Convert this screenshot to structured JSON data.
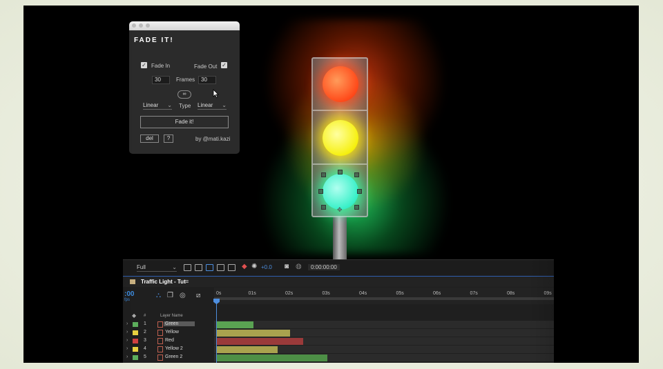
{
  "fade_panel": {
    "title": "FADE IT!",
    "fade_in_label": "Fade In",
    "fade_in_checked": true,
    "fade_out_label": "Fade Out",
    "fade_out_checked": true,
    "frames_label": "Frames",
    "frames_in": "30",
    "frames_out": "30",
    "link_icon": "link-icon",
    "type_label": "Type",
    "type_in": "Linear",
    "type_out": "Linear",
    "fade_button": "Fade it!",
    "del_button": "del",
    "help_button": "?",
    "credit": "by @mati.kazi"
  },
  "viewer_toolbar": {
    "resolution": "Full",
    "exposure": "+0.0",
    "timecode": "0:00:00:00"
  },
  "timeline": {
    "comp_tab": "Traffic Light - Tut",
    "current_time": ":00",
    "current_frame": "fps",
    "col_number": "#",
    "col_name": "Layer Name",
    "ticks": [
      "0s",
      "01s",
      "02s",
      "03s",
      "04s",
      "05s",
      "06s",
      "07s",
      "08s",
      "09s"
    ],
    "duration_seconds": 9.2,
    "layers": [
      {
        "num": "1",
        "name": "Green",
        "label_color": "#5cae5c",
        "bar_color": "#5aa352",
        "start": 0.0,
        "end": 1.0,
        "selected": true
      },
      {
        "num": "2",
        "name": "Yellow",
        "label_color": "#e8d040",
        "bar_color": "#a9a24e",
        "start": 0.0,
        "end": 2.0,
        "selected": false
      },
      {
        "num": "3",
        "name": "Red",
        "label_color": "#d04040",
        "bar_color": "#9a3a3a",
        "start": 0.0,
        "end": 2.35,
        "selected": false
      },
      {
        "num": "4",
        "name": "Yellow 2",
        "label_color": "#e8d040",
        "bar_color": "#a9a24e",
        "start": 0.0,
        "end": 1.67,
        "selected": false
      },
      {
        "num": "5",
        "name": "Green 2",
        "label_color": "#5cae5c",
        "bar_color": "#4d8f46",
        "start": 0.0,
        "end": 3.0,
        "selected": false
      }
    ]
  }
}
